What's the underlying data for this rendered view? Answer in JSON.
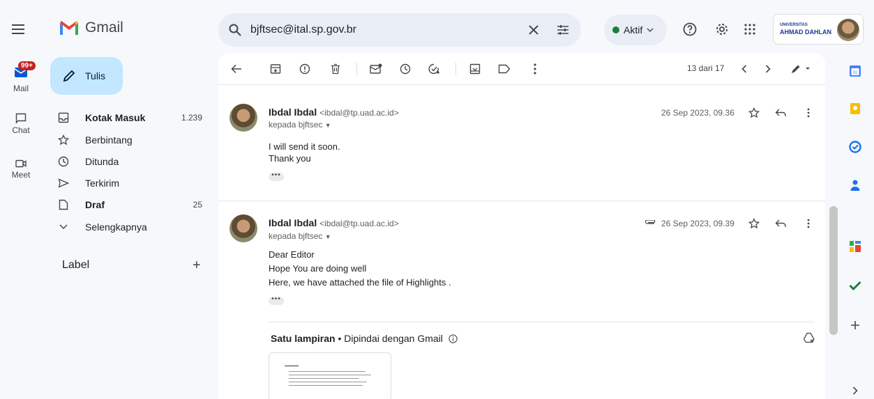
{
  "header": {
    "app_name": "Gmail",
    "search_value": "bjftsec@ital.sp.gov.br",
    "status_label": "Aktif",
    "org_line1": "UNIVERSITAS",
    "org_line2": "AHMAD DAHLAN"
  },
  "rail": {
    "mail_badge": "99+",
    "mail_label": "Mail",
    "chat_label": "Chat",
    "meet_label": "Meet"
  },
  "compose_label": "Tulis",
  "nav": [
    {
      "label": "Kotak Masuk",
      "count": "1.239",
      "bold": true
    },
    {
      "label": "Berbintang",
      "count": ""
    },
    {
      "label": "Ditunda",
      "count": ""
    },
    {
      "label": "Terkirim",
      "count": ""
    },
    {
      "label": "Draf",
      "count": "25",
      "bold": true
    },
    {
      "label": "Selengkapnya",
      "count": ""
    }
  ],
  "label_section": "Label",
  "label_add": "+",
  "pager_text": "13 dari 17",
  "messages": [
    {
      "sender": "Ibdal Ibdal",
      "email": "<ibdal@tp.uad.ac.id>",
      "to": "kepada bjftsec",
      "date": "26 Sep 2023, 09.36",
      "lines": [
        "I will send it soon.",
        "Thank you"
      ]
    },
    {
      "sender": "Ibdal Ibdal",
      "email": "<ibdal@tp.uad.ac.id>",
      "to": "kepada bjftsec",
      "date": "26 Sep 2023, 09.39",
      "lines": [
        "Dear Editor",
        "Hope You are doing well",
        "Here, we have attached the file of Highlights ."
      ]
    }
  ],
  "attachment": {
    "title": "Satu lampiran",
    "scan": " • Dipindai dengan Gmail"
  },
  "colors": {
    "accent": "#c2e7ff",
    "badge": "#c5221f",
    "status_dot": "#188038"
  }
}
